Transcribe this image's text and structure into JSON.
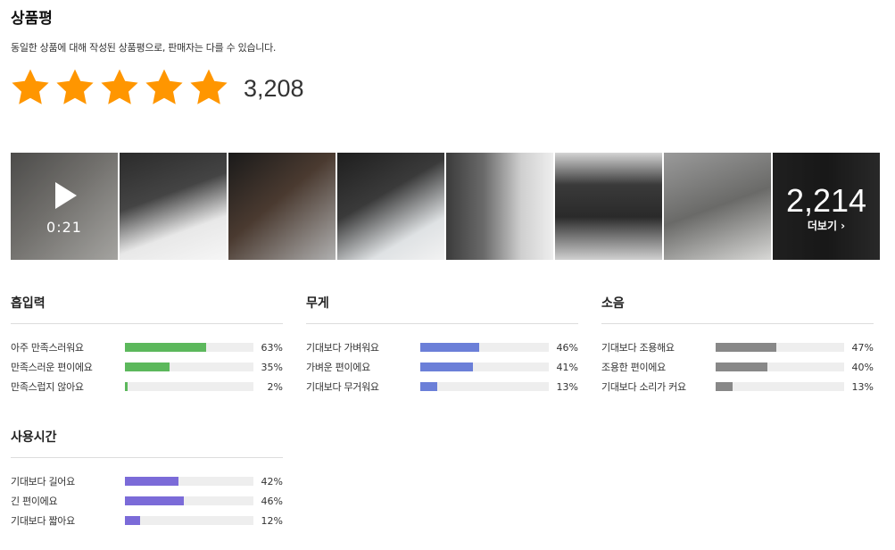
{
  "header": {
    "title": "상품평",
    "description": "동일한 상품에 대해 작성된 상품평으로, 판매자는 다를 수 있습니다."
  },
  "rating": {
    "stars_filled": 5,
    "stars_total": 5,
    "count": "3,208",
    "star_color": "#ff9600"
  },
  "photos": {
    "video_duration": "0:21",
    "more_count": "2,214",
    "more_label": "더보기"
  },
  "sections": [
    {
      "title": "흡입력",
      "color": "#5cb85c",
      "rows": [
        {
          "label": "아주 만족스러워요",
          "percent": "63%",
          "value": 63
        },
        {
          "label": "만족스러운 편이에요",
          "percent": "35%",
          "value": 35
        },
        {
          "label": "만족스럽지 않아요",
          "percent": "2%",
          "value": 2
        }
      ]
    },
    {
      "title": "무게",
      "color": "#6b7fd8",
      "rows": [
        {
          "label": "기대보다 가벼워요",
          "percent": "46%",
          "value": 46
        },
        {
          "label": "가벼운 편이에요",
          "percent": "41%",
          "value": 41
        },
        {
          "label": "기대보다 무거워요",
          "percent": "13%",
          "value": 13
        }
      ]
    },
    {
      "title": "소음",
      "color": "#888888",
      "rows": [
        {
          "label": "기대보다 조용해요",
          "percent": "47%",
          "value": 47
        },
        {
          "label": "조용한 편이에요",
          "percent": "40%",
          "value": 40
        },
        {
          "label": "기대보다 소리가 커요",
          "percent": "13%",
          "value": 13
        }
      ]
    },
    {
      "title": "사용시간",
      "color": "#7b6bd8",
      "rows": [
        {
          "label": "기대보다 길어요",
          "percent": "42%",
          "value": 42
        },
        {
          "label": "긴 편이에요",
          "percent": "46%",
          "value": 46
        },
        {
          "label": "기대보다 짧아요",
          "percent": "12%",
          "value": 12
        }
      ]
    }
  ]
}
